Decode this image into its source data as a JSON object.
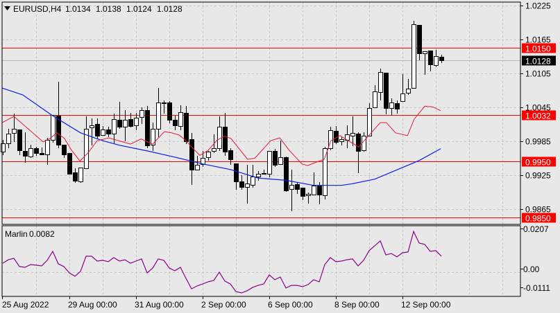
{
  "header": {
    "symbol": "EURUSD,H4",
    "open": "1.0134",
    "high": "1.0138",
    "low": "1.0124",
    "close": "1.0128"
  },
  "indicator": {
    "name": "Marlin",
    "value": "0.0082"
  },
  "colors": {
    "bull": "#ffffff",
    "bear": "#000000",
    "ma_fast": "#e8173a",
    "ma_slow": "#0a1ee8",
    "level": "#ff0000",
    "indicator": "#8b008b",
    "current": "#000000",
    "background": "#e8e8e8"
  },
  "chart_data": [
    {
      "type": "candlestick",
      "title": "EURUSD,H4",
      "ylim": [
        0.9845,
        1.0245
      ],
      "y_ticks": [
        "1.0225",
        "1.0165",
        "1.0105",
        "1.0045",
        "0.9985",
        "0.9925",
        "0.9865"
      ],
      "x_labels": [
        {
          "label": "25 Aug 2022",
          "index": 0
        },
        {
          "label": "29 Aug 00:00",
          "index": 12
        },
        {
          "label": "31 Aug 00:00",
          "index": 24
        },
        {
          "label": "2 Sep 00:00",
          "index": 36
        },
        {
          "label": "6 Sep 00:00",
          "index": 48
        },
        {
          "label": "8 Sep 00:00",
          "index": 60
        },
        {
          "label": "12 Sep 00:00",
          "index": 72
        }
      ],
      "levels": [
        "1.0150",
        "1.0032",
        "0.9950",
        "0.9850"
      ],
      "current_price": "1.0128",
      "grid": true,
      "ohlc": [
        [
          0.9967,
          0.9987,
          0.9962,
          0.9981
        ],
        [
          0.9981,
          1.0007,
          0.9974,
          0.9998
        ],
        [
          1.0,
          1.0034,
          0.9985,
          1.0007
        ],
        [
          1.0006,
          1.0006,
          0.9962,
          0.9969
        ],
        [
          0.9968,
          1.0001,
          0.9948,
          0.9959
        ],
        [
          0.9958,
          0.9979,
          0.9957,
          0.9973
        ],
        [
          0.9973,
          0.9975,
          0.996,
          0.9964
        ],
        [
          0.9964,
          0.9974,
          0.9962,
          0.9962
        ],
        [
          0.9962,
          0.9991,
          0.9945,
          0.9987
        ],
        [
          0.9987,
          1.0032,
          0.9984,
          1.0032
        ],
        [
          1.003,
          1.009,
          0.9974,
          0.9979
        ],
        [
          0.9979,
          0.9979,
          0.9957,
          0.9962
        ],
        [
          0.9964,
          0.9964,
          0.9927,
          0.9927
        ],
        [
          0.993,
          0.9937,
          0.9913,
          0.9915
        ],
        [
          0.9914,
          0.9938,
          0.9913,
          0.9938
        ],
        [
          0.9937,
          1.0029,
          0.9937,
          1.0007
        ],
        [
          1.001,
          1.0025,
          0.9979,
          1.0013
        ],
        [
          1.0016,
          1.0025,
          0.999,
          0.9995
        ],
        [
          0.9996,
          1.0012,
          0.9996,
          1.0006
        ],
        [
          1.0006,
          1.0011,
          0.9994,
          0.9998
        ],
        [
          0.9998,
          1.0034,
          0.9981,
          1.0024
        ],
        [
          1.0023,
          1.0055,
          1.0008,
          1.0011
        ],
        [
          1.0011,
          1.004,
          0.9986,
          1.0023
        ],
        [
          1.0024,
          1.0035,
          1.0011,
          1.0012
        ],
        [
          1.0013,
          1.0035,
          1.0006,
          1.0027
        ],
        [
          1.0028,
          1.0045,
          1.0017,
          1.004
        ],
        [
          1.004,
          1.0047,
          0.9974,
          0.9978
        ],
        [
          0.9979,
          1.0018,
          0.9969,
          1.0007
        ],
        [
          1.0007,
          1.0079,
          0.9994,
          1.0054
        ],
        [
          1.0052,
          1.0057,
          1.0035,
          1.0053
        ],
        [
          1.0054,
          1.0056,
          1.0018,
          1.0023
        ],
        [
          1.0023,
          1.003,
          1.0006,
          1.0013
        ],
        [
          1.0012,
          1.0049,
          1.0006,
          1.0037
        ],
        [
          1.0035,
          1.0047,
          0.9981,
          0.9985
        ],
        [
          0.9989,
          1.0,
          0.9909,
          0.9935
        ],
        [
          0.9935,
          0.9959,
          0.9935,
          0.9943
        ],
        [
          0.9945,
          0.9968,
          0.9941,
          0.9956
        ],
        [
          0.9957,
          0.9968,
          0.9952,
          0.9967
        ],
        [
          0.9968,
          0.9997,
          0.9965,
          0.9973
        ],
        [
          0.9973,
          1.0029,
          0.9969,
          1.0011
        ],
        [
          1.0011,
          1.0035,
          0.996,
          0.9967
        ],
        [
          0.9969,
          0.9973,
          0.9945,
          0.9953
        ],
        [
          0.9946,
          0.9946,
          0.99,
          0.9914
        ],
        [
          0.9914,
          0.9925,
          0.99,
          0.9904
        ],
        [
          0.9904,
          0.9943,
          0.9876,
          0.991
        ],
        [
          0.9908,
          0.9943,
          0.9904,
          0.9922
        ],
        [
          0.9922,
          0.9932,
          0.9916,
          0.9928
        ],
        [
          0.9928,
          0.9935,
          0.9927,
          0.9929
        ],
        [
          0.9928,
          0.9968,
          0.9922,
          0.9968
        ],
        [
          0.9968,
          0.9972,
          0.9941,
          0.9943
        ],
        [
          0.9945,
          0.9986,
          0.9945,
          0.9957
        ],
        [
          0.9957,
          0.9958,
          0.9897,
          0.9898
        ],
        [
          0.99,
          0.9935,
          0.9863,
          0.9908
        ],
        [
          0.9909,
          0.9913,
          0.9893,
          0.99
        ],
        [
          0.9903,
          0.9903,
          0.9882,
          0.9888
        ],
        [
          0.9889,
          0.9894,
          0.9876,
          0.9892
        ],
        [
          0.9891,
          0.993,
          0.9891,
          0.9907
        ],
        [
          0.9907,
          0.9913,
          0.9875,
          0.9891
        ],
        [
          0.9889,
          0.9975,
          0.9883,
          0.9973
        ],
        [
          0.9973,
          1.0011,
          0.997,
          1.0005
        ],
        [
          1.0003,
          1.0012,
          0.9981,
          0.9984
        ],
        [
          0.9985,
          0.9994,
          0.9979,
          0.9989
        ],
        [
          0.9987,
          1.0013,
          0.9974,
          0.9997
        ],
        [
          0.9995,
          1.0029,
          0.9978,
          1.0
        ],
        [
          0.9998,
          1.0001,
          0.993,
          0.9968
        ],
        [
          0.9969,
          1.0001,
          0.9968,
          0.9995
        ],
        [
          0.9995,
          1.0052,
          0.9995,
          1.0044
        ],
        [
          1.0045,
          1.0084,
          1.0045,
          1.0073
        ],
        [
          1.0072,
          1.0114,
          1.0058,
          1.0107
        ],
        [
          1.0106,
          1.0106,
          1.0034,
          1.0044
        ],
        [
          1.0044,
          1.0061,
          1.0032,
          1.0054
        ],
        [
          1.0052,
          1.0057,
          1.0035,
          1.0043
        ],
        [
          1.0056,
          1.0104,
          1.0056,
          1.0069
        ],
        [
          1.0071,
          1.0095,
          1.0068,
          1.0078
        ],
        [
          1.0079,
          1.0198,
          1.0079,
          1.0192
        ],
        [
          1.0191,
          1.0191,
          1.013,
          1.014
        ],
        [
          1.014,
          1.0144,
          1.0104,
          1.0144
        ],
        [
          1.0145,
          1.0145,
          1.011,
          1.0121
        ],
        [
          1.012,
          1.0147,
          1.0117,
          1.0136
        ],
        [
          1.0134,
          1.0138,
          1.0124,
          1.0128
        ]
      ],
      "ma_fast": [
        [
          -0.1,
          1.0018
        ],
        [
          2,
          1.0029
        ],
        [
          4.1,
          1.0011
        ],
        [
          7.25,
          0.9984
        ],
        [
          8.5,
          0.999
        ],
        [
          9.75,
          1.0
        ],
        [
          11.1,
          0.999
        ],
        [
          12.4,
          0.9969
        ],
        [
          13.9,
          0.995
        ],
        [
          15.4,
          0.9965
        ],
        [
          17,
          0.9986
        ],
        [
          19.1,
          0.9991
        ],
        [
          23,
          0.998
        ],
        [
          24.9,
          0.9989
        ],
        [
          27,
          0.998
        ],
        [
          29.1,
          1.0002
        ],
        [
          30.4,
          1.0
        ],
        [
          31.75,
          0.9996
        ],
        [
          32.9,
          0.9987
        ],
        [
          34.1,
          0.9974
        ],
        [
          35.5,
          0.996
        ],
        [
          37,
          0.9969
        ],
        [
          38.6,
          0.9987
        ],
        [
          39.9,
          0.9994
        ],
        [
          41.1,
          0.999
        ],
        [
          44.1,
          0.9953
        ],
        [
          45.4,
          0.9955
        ],
        [
          48.25,
          0.9986
        ],
        [
          49.9,
          0.9991
        ],
        [
          51.6,
          0.9969
        ],
        [
          53.9,
          0.9945
        ],
        [
          54.9,
          0.9942
        ],
        [
          57,
          0.995
        ],
        [
          57.9,
          0.9953
        ],
        [
          59.1,
          0.9986
        ],
        [
          60.75,
          0.9995
        ],
        [
          64.1,
          0.9975
        ],
        [
          68,
          1.0018
        ],
        [
          69.1,
          1.0018
        ],
        [
          70.75,
          1.0
        ],
        [
          72.9,
          0.9995
        ],
        [
          74.1,
          1.0024
        ],
        [
          76,
          1.0047
        ],
        [
          77.4,
          1.0046
        ],
        [
          78.9,
          1.0039
        ]
      ],
      "ma_slow": [
        [
          -0.1,
          1.0079
        ],
        [
          3.6,
          1.0067
        ],
        [
          9,
          1.003
        ],
        [
          14,
          1.0
        ],
        [
          18,
          0.9986
        ],
        [
          21,
          0.9978
        ],
        [
          26,
          0.9968
        ],
        [
          31,
          0.9957
        ],
        [
          36,
          0.9945
        ],
        [
          41,
          0.9935
        ],
        [
          46,
          0.992
        ],
        [
          51,
          0.9916
        ],
        [
          56,
          0.9907
        ],
        [
          61,
          0.9907
        ],
        [
          63,
          0.991
        ],
        [
          67,
          0.9918
        ],
        [
          75,
          0.9951
        ],
        [
          78.9,
          0.9972
        ]
      ]
    },
    {
      "type": "line",
      "title": "Marlin 0.0082",
      "ylim": [
        -0.0125,
        0.0225
      ],
      "y_ticks": [
        "0.0207",
        "0.00",
        "-0.0111"
      ],
      "values": [
        0.0046,
        0.0064,
        0.0071,
        0.0029,
        0.0025,
        0.0039,
        0.0036,
        0.0032,
        0.0061,
        0.0107,
        0.0043,
        0.0029,
        -0.0004,
        -0.0021,
        0.0004,
        0.0082,
        0.0082,
        0.0057,
        0.0061,
        0.0054,
        0.0075,
        0.0057,
        0.0064,
        0.0046,
        0.0057,
        0.0068,
        -0.0004,
        0.0021,
        0.0068,
        0.0061,
        0.0021,
        0.0007,
        0.0025,
        -0.0032,
        -0.0086,
        -0.0071,
        -0.0061,
        -0.005,
        -0.0043,
        0.0,
        -0.0046,
        -0.0061,
        -0.01,
        -0.0107,
        -0.0096,
        -0.0079,
        -0.0068,
        -0.0061,
        -0.0014,
        -0.0039,
        -0.0025,
        -0.0082,
        -0.0068,
        -0.0068,
        -0.0075,
        -0.0064,
        -0.0039,
        -0.005,
        0.0039,
        0.0075,
        0.0054,
        0.0057,
        0.0064,
        0.0068,
        0.0032,
        0.0061,
        0.0111,
        0.0136,
        0.0161,
        0.0089,
        0.0096,
        0.0079,
        0.01,
        0.0104,
        0.021,
        0.015,
        0.0143,
        0.0107,
        0.0111,
        0.0082
      ]
    }
  ]
}
